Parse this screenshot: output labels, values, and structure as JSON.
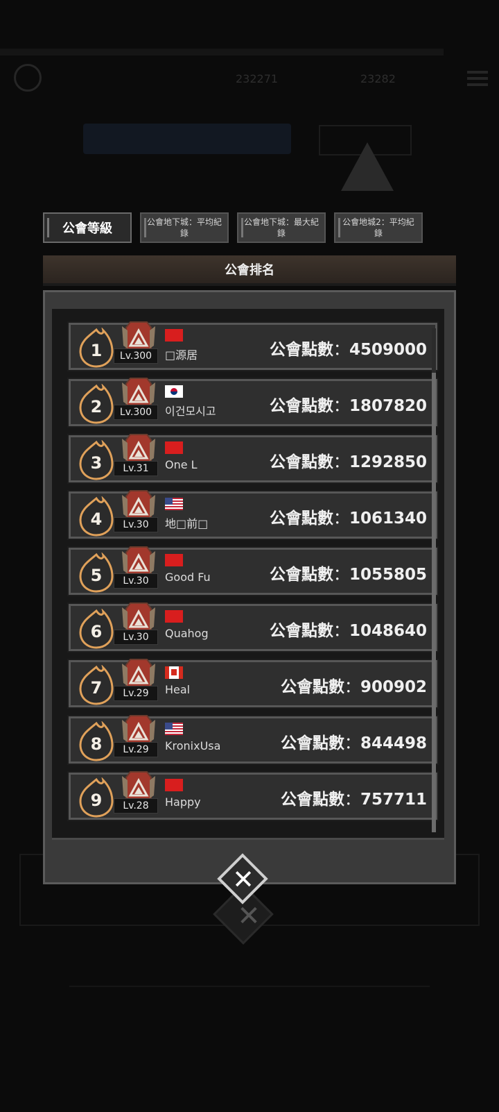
{
  "tabs": [
    {
      "label": "公會等級",
      "active": true
    },
    {
      "label": "公會地下城：平均紀錄",
      "active": false
    },
    {
      "label": "公會地下城：最大紀錄",
      "active": false
    },
    {
      "label": "公會地城2：平均紀錄",
      "active": false
    }
  ],
  "panel": {
    "title": "公會排名",
    "points_label": "公會點數",
    "separator": "："
  },
  "rankings": [
    {
      "rank": "1",
      "level": "Lv.300",
      "flag": "cn",
      "name": "□源居",
      "points": "4509000"
    },
    {
      "rank": "2",
      "level": "Lv.300",
      "flag": "kr",
      "name": "이건모시고",
      "points": "1807820"
    },
    {
      "rank": "3",
      "level": "Lv.31",
      "flag": "cn",
      "name": "One L",
      "points": "1292850"
    },
    {
      "rank": "4",
      "level": "Lv.30",
      "flag": "us",
      "name": "地□前□",
      "points": "1061340"
    },
    {
      "rank": "5",
      "level": "Lv.30",
      "flag": "cn",
      "name": "Good Fu",
      "points": "1055805"
    },
    {
      "rank": "6",
      "level": "Lv.30",
      "flag": "cn",
      "name": "Quahog",
      "points": "1048640"
    },
    {
      "rank": "7",
      "level": "Lv.29",
      "flag": "ca",
      "name": "Heal",
      "points": "900902"
    },
    {
      "rank": "8",
      "level": "Lv.29",
      "flag": "us",
      "name": "KronixUsa",
      "points": "844498"
    },
    {
      "rank": "9",
      "level": "Lv.28",
      "flag": "cn",
      "name": "Happy",
      "points": "757711"
    }
  ],
  "background": {
    "hud_value_1": "232271",
    "hud_value_2": "23282"
  },
  "colors": {
    "badge_fill": "#2b2b2b",
    "badge_stroke": "#e0a15a",
    "emblem_red": "#a2382c"
  }
}
